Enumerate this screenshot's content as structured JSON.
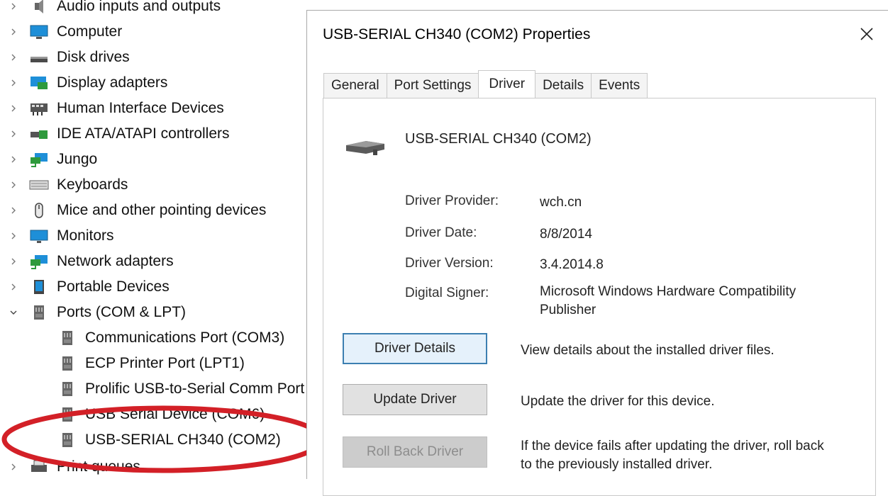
{
  "tree": {
    "items": [
      {
        "label": "Audio inputs and outputs",
        "icon": "speaker-icon"
      },
      {
        "label": "Computer",
        "icon": "monitor-icon"
      },
      {
        "label": "Disk drives",
        "icon": "disk-drive-icon"
      },
      {
        "label": "Display adapters",
        "icon": "display-adapter-icon"
      },
      {
        "label": "Human Interface Devices",
        "icon": "hid-icon"
      },
      {
        "label": "IDE ATA/ATAPI controllers",
        "icon": "ide-controller-icon"
      },
      {
        "label": "Jungo",
        "icon": "network-icon"
      },
      {
        "label": "Keyboards",
        "icon": "keyboard-icon"
      },
      {
        "label": "Mice and other pointing devices",
        "icon": "mouse-icon"
      },
      {
        "label": "Monitors",
        "icon": "monitor-icon"
      },
      {
        "label": "Network adapters",
        "icon": "network-icon"
      },
      {
        "label": "Portable Devices",
        "icon": "portable-device-icon"
      },
      {
        "label": "Ports (COM & LPT)",
        "icon": "port-icon"
      },
      {
        "label": "Print queues",
        "icon": "printer-icon"
      }
    ],
    "port_children": [
      {
        "label": "Communications Port (COM3)"
      },
      {
        "label": "ECP Printer Port (LPT1)"
      },
      {
        "label": "Prolific USB-to-Serial Comm Port"
      },
      {
        "label": "USB Serial Device (COM6)"
      },
      {
        "label": "USB-SERIAL CH340 (COM2)"
      }
    ],
    "highlight_color": "#d32027"
  },
  "dialog": {
    "title": "USB-SERIAL CH340 (COM2) Properties",
    "tabs": [
      "General",
      "Port Settings",
      "Driver",
      "Details",
      "Events"
    ],
    "active_tab": "Driver",
    "device_name": "USB-SERIAL CH340 (COM2)",
    "info": [
      {
        "label": "Driver Provider:",
        "value": "wch.cn"
      },
      {
        "label": "Driver Date:",
        "value": "8/8/2014"
      },
      {
        "label": "Driver Version:",
        "value": "3.4.2014.8"
      },
      {
        "label": "Digital Signer:",
        "value": "Microsoft Windows Hardware Compatibility Publisher"
      }
    ],
    "buttons": [
      {
        "label": "Driver Details",
        "description": "View details about the installed driver files."
      },
      {
        "label": "Update Driver",
        "description": "Update the driver for this device."
      },
      {
        "label": "Roll Back Driver",
        "description": "If the device fails after updating the driver, roll back to the previously installed driver."
      }
    ]
  }
}
